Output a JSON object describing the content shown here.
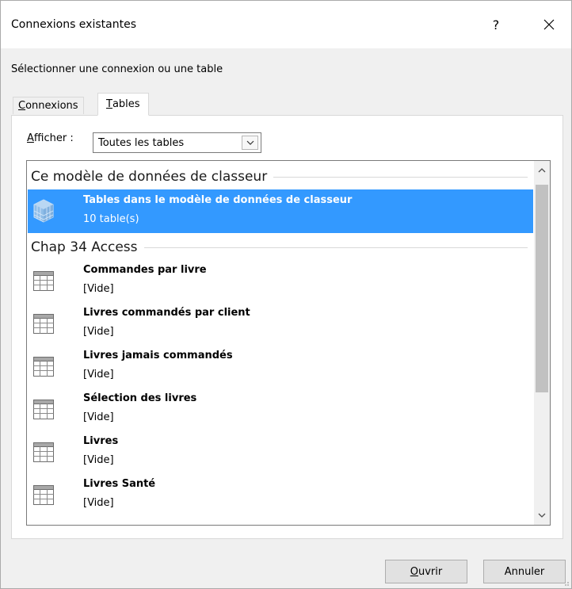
{
  "window": {
    "title": "Connexions existantes",
    "help_label": "?",
    "close_label": "✕"
  },
  "prompt": "Sélectionner une connexion ou une table",
  "tabs": [
    {
      "label_rest": "onnexions",
      "accel": "C",
      "active": false
    },
    {
      "label_rest": "ables",
      "accel": "T",
      "active": true
    }
  ],
  "filter": {
    "label_accel": "A",
    "label_rest": "fficher :",
    "selected": "Toutes les tables"
  },
  "groups": [
    {
      "header": "Ce modèle de données de classeur",
      "items": [
        {
          "name": "Tables dans le modèle de données de classeur",
          "sub": "10 table(s)",
          "icon": "data-model-cube-icon",
          "selected": true
        }
      ]
    },
    {
      "header": "Chap 34 Access",
      "items": [
        {
          "name": "Commandes par livre",
          "sub": "[Vide]",
          "icon": "table-icon"
        },
        {
          "name": "Livres commandés par client",
          "sub": "[Vide]",
          "icon": "table-icon"
        },
        {
          "name": "Livres jamais commandés",
          "sub": "[Vide]",
          "icon": "table-icon"
        },
        {
          "name": "Sélection des livres",
          "sub": "[Vide]",
          "icon": "table-icon"
        },
        {
          "name": "Livres",
          "sub": "[Vide]",
          "icon": "table-icon"
        },
        {
          "name": "Livres Santé",
          "sub": "[Vide]",
          "icon": "table-icon"
        }
      ]
    }
  ],
  "buttons": {
    "open_accel": "O",
    "open_rest": "uvrir",
    "cancel": "Annuler"
  },
  "colors": {
    "selection": "#3399ff",
    "background": "#f0f0f0"
  }
}
